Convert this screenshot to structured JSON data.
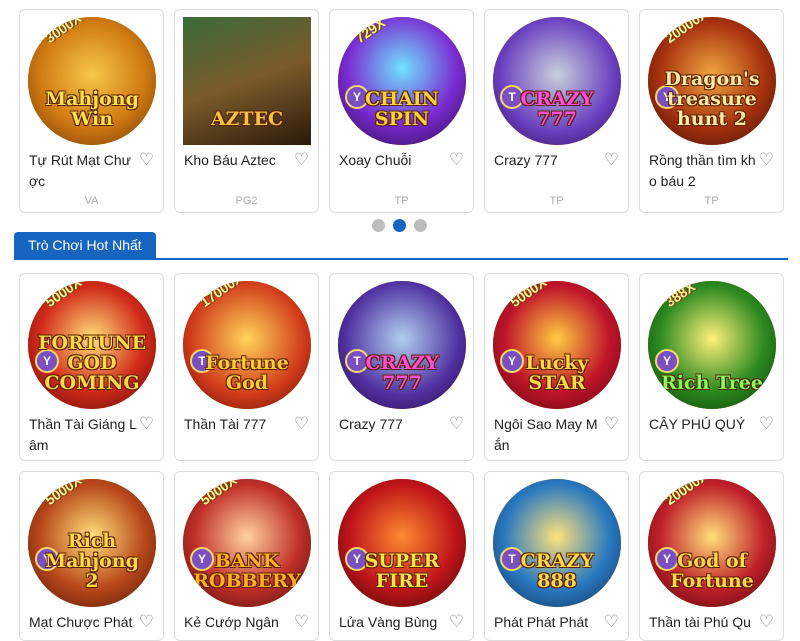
{
  "carousel": {
    "items": [
      {
        "title": "Tự Rút Mạt Chược",
        "provider": "VA",
        "mult": "3000X",
        "logo": "Mahjong Win",
        "badge": "",
        "logo_color": "#ffe14a"
      },
      {
        "title": "Kho Báu Aztec",
        "provider": "PG2",
        "mult": "",
        "logo": "AZTEC",
        "badge": "",
        "logo_color": "#f5c542"
      },
      {
        "title": "Xoay Chuỗi",
        "provider": "TP",
        "mult": "729X",
        "logo": "CHAIN SPIN",
        "badge": "Y",
        "logo_color": "#ffd23a"
      },
      {
        "title": "Crazy 777",
        "provider": "TP",
        "mult": "",
        "logo": "CRAZY 777",
        "badge": "T",
        "logo_color": "#ff4fd8"
      },
      {
        "title": "Rồng thần tìm kho báu 2",
        "provider": "TP",
        "mult": "20000X",
        "logo": "Dragon's treasure hunt 2",
        "badge": "Y",
        "logo_color": "#ffe9a0"
      }
    ],
    "page_dots": 3,
    "active_dot": 1
  },
  "hot_section": {
    "title": "Trò Chơi Hot Nhất",
    "items": [
      {
        "title": "Thần Tài Giáng Lâm",
        "mult": "5000X",
        "logo": "FORTUNE GOD COMING",
        "badge": "Y",
        "logo_color": "#ffd84a"
      },
      {
        "title": "Thần Tài 777",
        "mult": "17000X",
        "logo": "Fortune God",
        "badge": "T",
        "logo_color": "#ffcc33"
      },
      {
        "title": "Crazy 777",
        "mult": "",
        "logo": "CRAZY 777",
        "badge": "T",
        "logo_color": "#ff4fd8"
      },
      {
        "title": "Ngôi Sao May Mắn",
        "mult": "5000X",
        "logo": "Lucky STAR",
        "badge": "Y",
        "logo_color": "#ffd84a"
      },
      {
        "title": "CÂY PHÚ QUÝ",
        "mult": "388X",
        "logo": "Rich Tree",
        "badge": "Y",
        "logo_color": "#7dff5a"
      },
      {
        "title": "Mạt Chược Phát",
        "mult": "5000X",
        "logo": "Rich Mahjong 2",
        "badge": "Y",
        "logo_color": "#ffd84a"
      },
      {
        "title": "Kẻ Cướp Ngân",
        "mult": "5000X",
        "logo": "BANK ROBBERY",
        "badge": "Y",
        "logo_color": "#ffb020"
      },
      {
        "title": "Lửa Vàng Bùng",
        "mult": "",
        "logo": "SUPER FIRE",
        "badge": "Y",
        "logo_color": "#ffe14a"
      },
      {
        "title": "Phát Phát Phát",
        "mult": "",
        "logo": "CRAZY 888",
        "badge": "T",
        "logo_color": "#ffd84a"
      },
      {
        "title": "Thần tài Phú Qu",
        "mult": "20000X",
        "logo": "God of Fortune",
        "badge": "Y",
        "logo_color": "#ffd84a"
      }
    ]
  },
  "colors": {
    "accent": "#1565c0",
    "heart": "#8a8a8a",
    "card_border": "#dcdcdc"
  },
  "icons": {
    "favorite": "heart-outline-icon"
  }
}
